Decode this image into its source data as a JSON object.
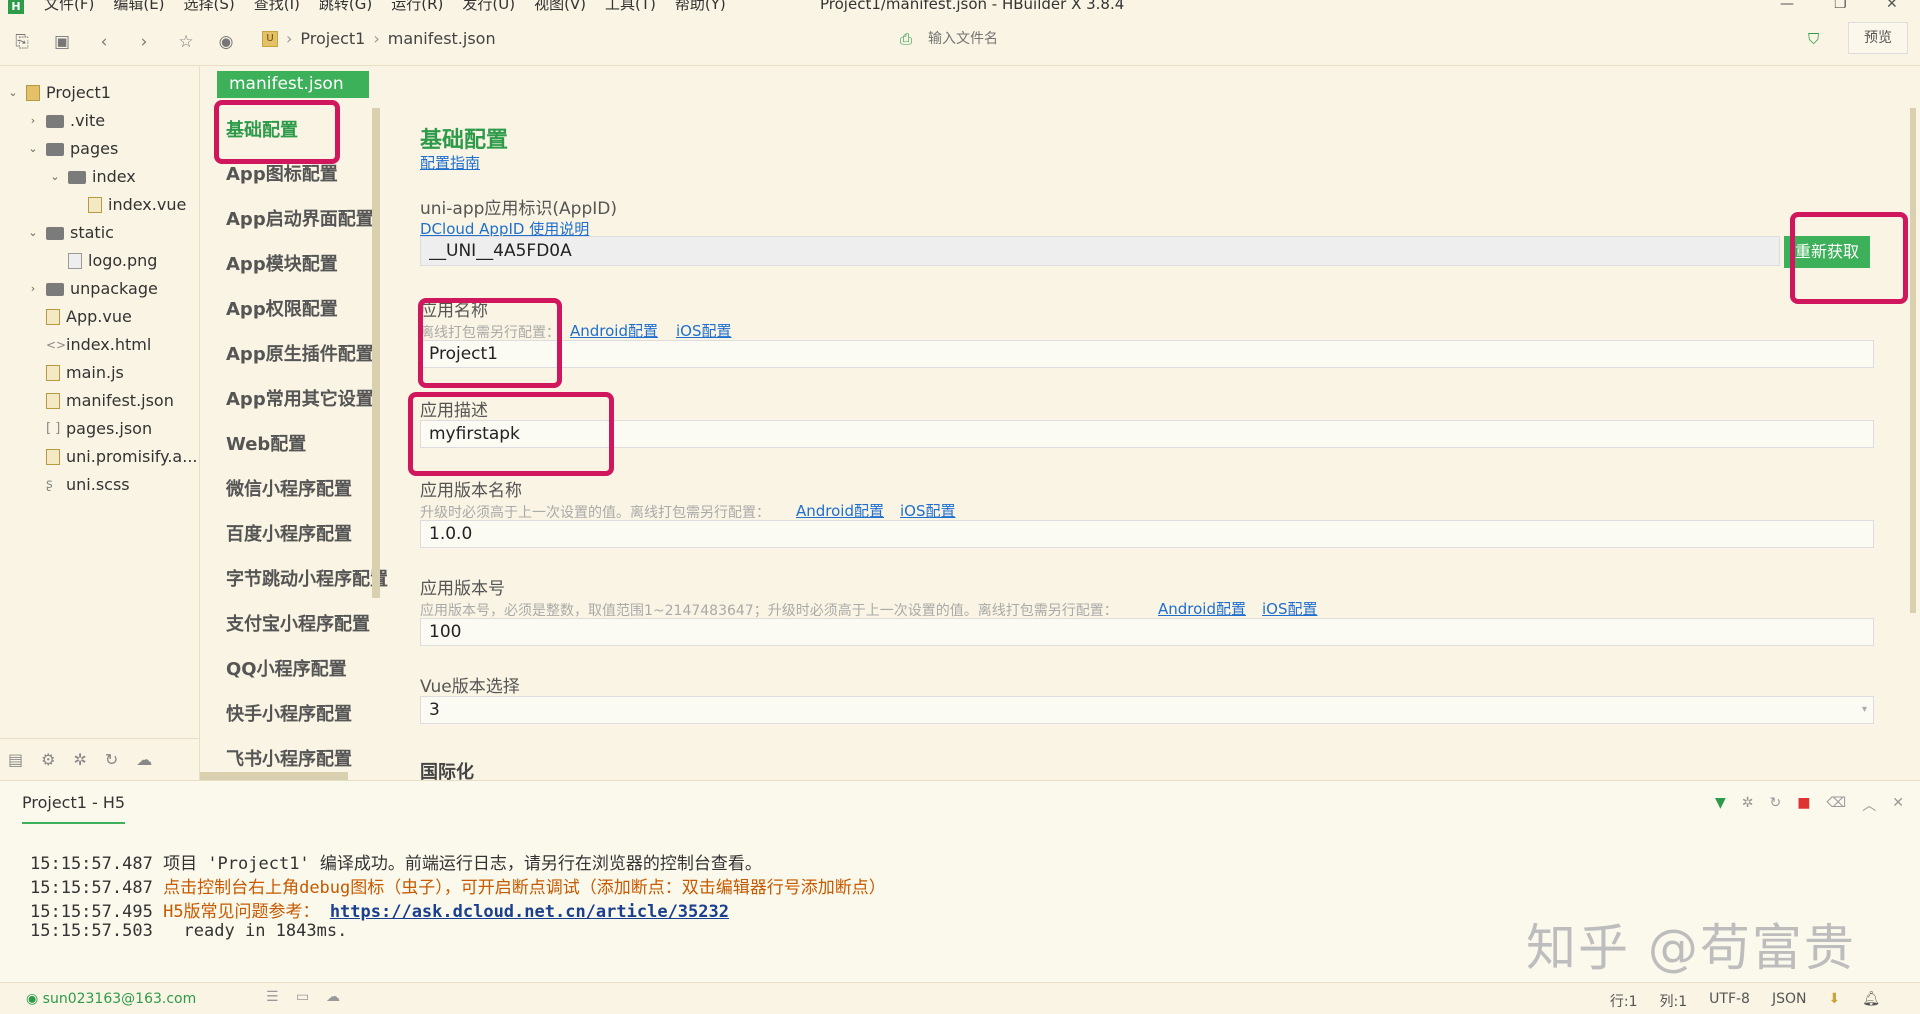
{
  "titlebar": {
    "logo": "H",
    "menus": [
      "文件(F)",
      "编辑(E)",
      "选择(S)",
      "查找(I)",
      "跳转(G)",
      "运行(R)",
      "发行(U)",
      "视图(V)",
      "工具(T)",
      "帮助(Y)"
    ],
    "window_title": "Project1/manifest.json - HBuilder X 3.8.4"
  },
  "toolbar": {
    "breadcrumb_project": "Project1",
    "breadcrumb_file": "manifest.json",
    "file_input_placeholder": "输入文件名",
    "preview_label": "预览"
  },
  "tree": [
    {
      "name": "Project1",
      "type": "project",
      "open": true
    },
    {
      "name": ".vite",
      "type": "folder",
      "open": false
    },
    {
      "name": "pages",
      "type": "folder",
      "open": true
    },
    {
      "name": "index",
      "type": "folder",
      "open": true
    },
    {
      "name": "index.vue",
      "type": "file"
    },
    {
      "name": "static",
      "type": "folder",
      "open": true
    },
    {
      "name": "logo.png",
      "type": "file"
    },
    {
      "name": "unpackage",
      "type": "folder",
      "open": false
    },
    {
      "name": "App.vue",
      "type": "file"
    },
    {
      "name": "index.html",
      "type": "file"
    },
    {
      "name": "main.js",
      "type": "file"
    },
    {
      "name": "manifest.json",
      "type": "file"
    },
    {
      "name": "pages.json",
      "type": "file"
    },
    {
      "name": "uni.promisify.a...",
      "type": "file"
    },
    {
      "name": "uni.scss",
      "type": "file"
    }
  ],
  "editor_tab": "manifest.json",
  "config_nav": [
    "基础配置",
    "App图标配置",
    "App启动界面配置",
    "App模块配置",
    "App权限配置",
    "App原生插件配置",
    "App常用其它设置",
    "Web配置",
    "微信小程序配置",
    "百度小程序配置",
    "字节跳动小程序配置",
    "支付宝小程序配置",
    "QQ小程序配置",
    "快手小程序配置",
    "飞书小程序配置"
  ],
  "form": {
    "section_title": "基础配置",
    "guide_link": "配置指南",
    "appid": {
      "label": "uni-app应用标识(AppID)",
      "link": "DCloud AppID 使用说明",
      "value": "__UNI__4A5FD0A",
      "button": "重新获取"
    },
    "appname": {
      "label": "应用名称",
      "hint": "离线打包需另行配置：",
      "android": "Android配置",
      "ios": "iOS配置",
      "value": "Project1"
    },
    "appdesc": {
      "label": "应用描述",
      "value": "myfirstapk"
    },
    "version_name": {
      "label": "应用版本名称",
      "hint": "升级时必须高于上一次设置的值。离线打包需另行配置：",
      "android": "Android配置",
      "ios": "iOS配置",
      "value": "1.0.0"
    },
    "version_code": {
      "label": "应用版本号",
      "hint": "应用版本号，必须是整数，取值范围1~2147483647；升级时必须高于上一次设置的值。离线打包需另行配置：",
      "android": "Android配置",
      "ios": "iOS配置",
      "value": "100"
    },
    "vue_version": {
      "label": "Vue版本选择",
      "value": "3"
    },
    "i18n_title": "国际化"
  },
  "console": {
    "tab": "Project1 - H5",
    "lines": [
      {
        "time": "15:15:57.487",
        "text": "项目 'Project1' 编译成功。前端运行日志，请另行在浏览器的控制台查看。"
      },
      {
        "time": "15:15:57.487",
        "text": "点击控制台右上角debug图标（虫子），可开启断点调试（添加断点：双击编辑器行号添加断点）"
      },
      {
        "time": "15:15:57.495",
        "prefix": "H5版常见问题参考：",
        "link": "https://ask.dcloud.net.cn/article/35232"
      },
      {
        "time": "15:15:57.503",
        "text": "  ready in 1843ms."
      }
    ]
  },
  "watermark": "知乎 @苟富贵",
  "status": {
    "user": "sun023163@163.com",
    "row": "行:1",
    "col": "列:1",
    "encoding": "UTF-8",
    "lang": "JSON"
  }
}
